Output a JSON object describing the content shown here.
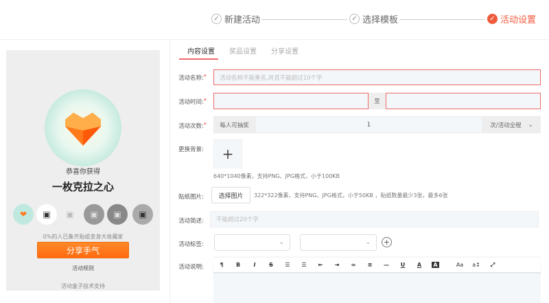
{
  "steps": [
    {
      "label": "新建活动",
      "state": "done"
    },
    {
      "label": "选择模板",
      "state": "done"
    },
    {
      "label": "活动设置",
      "state": "active"
    }
  ],
  "preview": {
    "congrats": "恭喜你获得",
    "prize": "一枚克拉之心",
    "progress_text": "0%的人已集齐贴纸变身大收藏家",
    "share_button": "分享手气",
    "rules_link": "活动规则",
    "footer": "活动盒子技术支持",
    "stickers": [
      "heart-sticker",
      "robot-sticker",
      "robot-sticker",
      "robot-sticker",
      "robot-sticker",
      "robot-sticker"
    ]
  },
  "tabs": [
    {
      "label": "内容设置",
      "active": true
    },
    {
      "label": "奖品设置"
    },
    {
      "label": "分享设置"
    }
  ],
  "form": {
    "name": {
      "label": "活动名称:",
      "placeholder": "活动名称不能重名,并且不能超过10个字"
    },
    "time": {
      "label": "活动时间:",
      "separator": "至"
    },
    "count": {
      "label": "活动次数:",
      "prefix": "每人可抽奖",
      "value": "1",
      "suffix": "次/活动全程"
    },
    "background": {
      "label": "更换背景:",
      "add": "+",
      "hint": "640*1040像素，支持PNG、JPG格式，小于100KB"
    },
    "sticker": {
      "label": "贴纸图片:",
      "button": "选择图片",
      "hint": "322*322像素，支持PNG、JPG格式，小于50KB ，贴纸数量最少3张，最多6张"
    },
    "brief": {
      "label": "活动简述:",
      "placeholder": "不能超过20个字"
    },
    "tags": {
      "label": "活动标签:"
    },
    "desc": {
      "label": "活动说明:",
      "toolbar": [
        "¶",
        "B",
        "I",
        "S",
        "☰",
        "☰",
        "⇤",
        "⇥",
        "∞",
        "≡",
        "—",
        "U",
        "A",
        "A",
        "Aa",
        "a↕",
        "⤢"
      ]
    }
  },
  "colors": {
    "accent": "#f05a3c",
    "error": "#f06a6a",
    "share": "#ff7a1a"
  }
}
